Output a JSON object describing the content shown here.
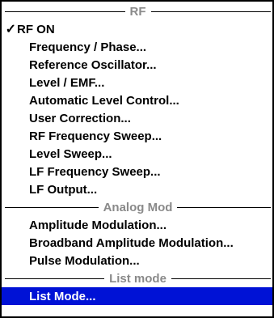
{
  "menu": {
    "sections": {
      "rf": {
        "title": "RF",
        "items": [
          {
            "label": "RF ON",
            "checked": true
          },
          {
            "label": "Frequency / Phase..."
          },
          {
            "label": "Reference Oscillator..."
          },
          {
            "label": "Level / EMF..."
          },
          {
            "label": "Automatic Level Control..."
          },
          {
            "label": "User Correction..."
          },
          {
            "label": "RF Frequency Sweep..."
          },
          {
            "label": "Level Sweep..."
          },
          {
            "label": "LF Frequency Sweep..."
          },
          {
            "label": "LF Output..."
          }
        ]
      },
      "analog_mod": {
        "title": "Analog Mod",
        "items": [
          {
            "label": "Amplitude Modulation..."
          },
          {
            "label": "Broadband Amplitude Modulation..."
          },
          {
            "label": "Pulse Modulation..."
          }
        ]
      },
      "list_mode": {
        "title": "List mode",
        "items": [
          {
            "label": "List Mode...",
            "selected": true
          }
        ]
      }
    },
    "check_glyph": "✓",
    "colors": {
      "selection_background": "#0012d6",
      "selection_text": "#ffffff",
      "header_text": "#8a8a8a"
    }
  }
}
